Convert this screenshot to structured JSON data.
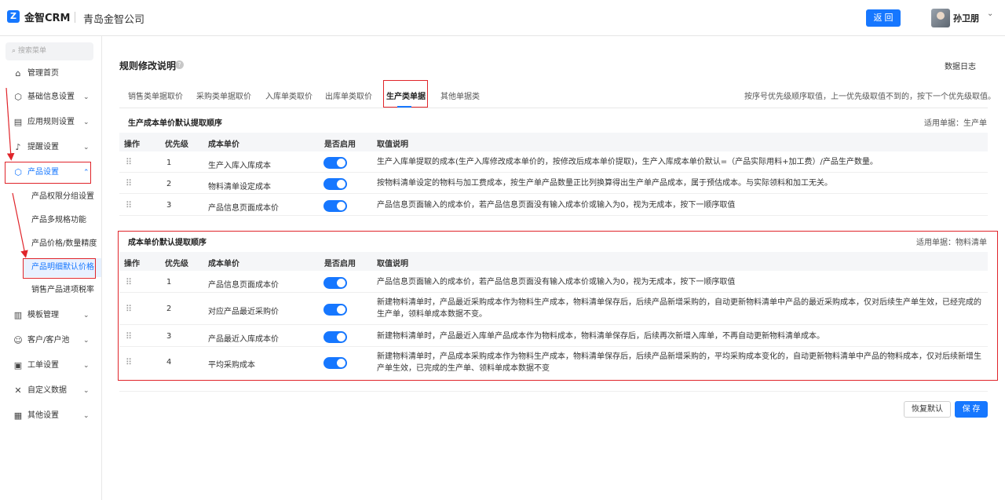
{
  "header": {
    "logo_mark": "Z",
    "app_name": "金智CRM",
    "company": "青岛金智公司",
    "back_label": "返 回",
    "user_name": "孙卫朋",
    "user_chevron": "⌄"
  },
  "sidebar": {
    "search_placeholder": "搜索菜单",
    "items": [
      {
        "label": "管理首页",
        "icon": "home-icon",
        "glyph": "⌂",
        "chevron": ""
      },
      {
        "label": "基础信息设置",
        "icon": "cube-icon",
        "glyph": "⬡",
        "chevron": "⌄"
      },
      {
        "label": "应用规则设置",
        "icon": "document-icon",
        "glyph": "▤",
        "chevron": "⌄"
      },
      {
        "label": "提醒设置",
        "icon": "bell-icon",
        "glyph": "♪",
        "chevron": "⌄"
      },
      {
        "label": "产品设置",
        "icon": "box-icon",
        "glyph": "⬡",
        "chevron": "⌃"
      },
      {
        "label": "模板管理",
        "icon": "template-icon",
        "glyph": "▥",
        "chevron": "⌄"
      },
      {
        "label": "客户/客户池",
        "icon": "customer-icon",
        "glyph": "☺",
        "chevron": "⌄"
      },
      {
        "label": "工单设置",
        "icon": "ticket-icon",
        "glyph": "▣",
        "chevron": "⌄"
      },
      {
        "label": "自定义数据",
        "icon": "tools-icon",
        "glyph": "✕",
        "chevron": "⌄"
      },
      {
        "label": "其他设置",
        "icon": "grid-icon",
        "glyph": "▦",
        "chevron": "⌄"
      }
    ],
    "sub_items": [
      "产品权限分组设置",
      "产品多规格功能",
      "产品价格/数量精度",
      "产品明细默认价格",
      "销售产品进项税率"
    ]
  },
  "main": {
    "title": "规则修改说明",
    "help_glyph": "?",
    "data_log": "数据日志",
    "tabs": [
      "销售类单据取价",
      "采购类单据取价",
      "入库单类取价",
      "出库单类取价",
      "生产类单据",
      "其他单据类"
    ],
    "active_tab": "生产类单据",
    "hint": "按序号优先级顺序取值，上一优先级取值不到的，按下一个优先级取值。",
    "columns": [
      "操作",
      "优先级",
      "成本单价",
      "是否启用",
      "取值说明"
    ],
    "drag_glyph": "⠿",
    "section1": {
      "title": "生产成本单价默认提取顺序",
      "apply": "适用单据：生产单",
      "rows": [
        {
          "priority": "1",
          "name": "生产入库入库成本",
          "enabled": true,
          "desc": "生产入库单提取的成本(生产入库修改成本单价的，按修改后成本单价提取)，生产入库成本单价默认=（产品实际用料+加工费）/产品生产数量。"
        },
        {
          "priority": "2",
          "name": "物料清单设定成本",
          "enabled": true,
          "desc": "按物料清单设定的物料与加工费成本，按生产单产品数量正比列换算得出生产单产品成本，属于预估成本。与实际领料和加工无关。"
        },
        {
          "priority": "3",
          "name": "产品信息页面成本价",
          "enabled": true,
          "desc": "产品信息页面输入的成本价，若产品信息页面没有输入成本价或输入为0，视为无成本，按下一顺序取值"
        }
      ]
    },
    "section2": {
      "title": "成本单价默认提取顺序",
      "apply": "适用单据：物料清单",
      "rows": [
        {
          "priority": "1",
          "name": "产品信息页面成本价",
          "enabled": true,
          "desc": "产品信息页面输入的成本价，若产品信息页面没有输入成本价或输入为0，视为无成本，按下一顺序取值"
        },
        {
          "priority": "2",
          "name": "对应产品最近采购价",
          "enabled": true,
          "desc": "新建物料清单时，产品最近采购成本作为物料生产成本，物料清单保存后，后续产品新增采购的，自动更新物料清单中产品的最近采购成本，仅对后续生产单生效，已经完成的生产单，领料单成本数据不变。"
        },
        {
          "priority": "3",
          "name": "产品最近入库成本价",
          "enabled": true,
          "desc": "新建物料清单时，产品最近入库单产品成本作为物料成本，物料清单保存后，后续再次新增入库单，不再自动更新物料清单成本。"
        },
        {
          "priority": "4",
          "name": "平均采购成本",
          "enabled": true,
          "desc": "新建物料清单时，产品成本采购成本作为物料生产成本，物料清单保存后，后续产品新增采购的，平均采购成本变化的，自动更新物料清单中产品的物料成本，仅对后续新增生产单生效，已完成的生产单、领料单成本数据不变"
        }
      ]
    },
    "reset_label": "恢复默认",
    "save_label": "保 存"
  },
  "colors": {
    "accent": "#1677ff",
    "annotation_red": "#e0242a"
  }
}
